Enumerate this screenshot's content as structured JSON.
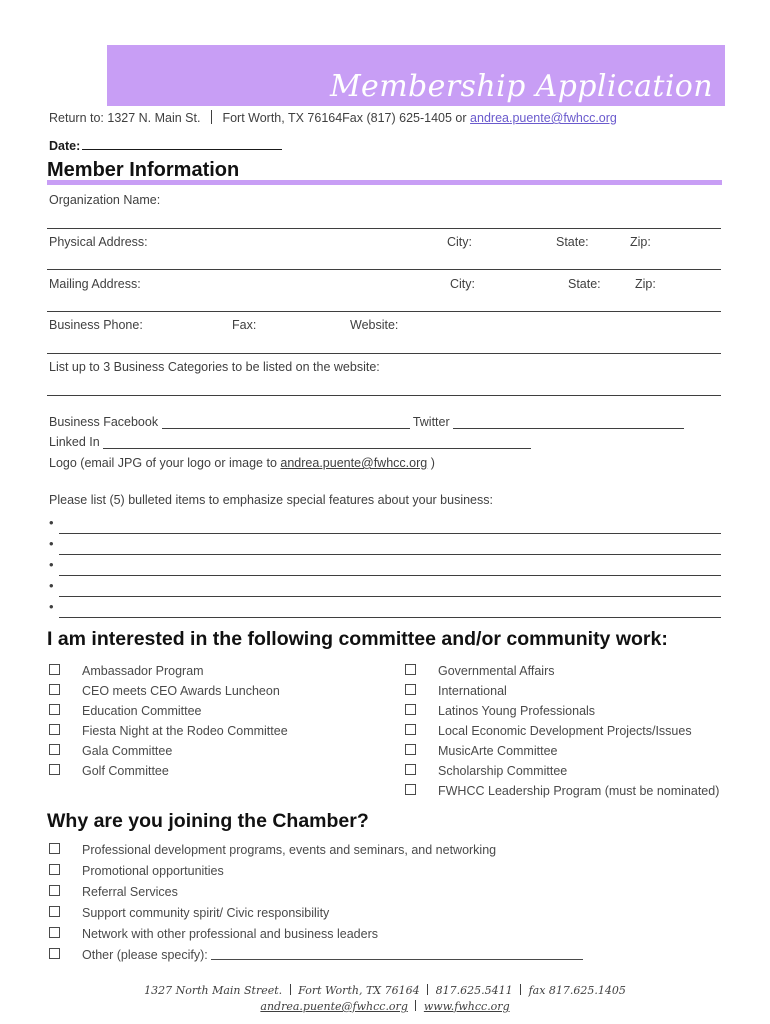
{
  "document": {
    "title": "Membership Application",
    "accent_color": "#c89ef5",
    "link_color": "#6a5acd"
  },
  "header": {
    "banner_title": "Membership Application"
  },
  "return_line": {
    "prefix": "Return to: 1327 N. Main St.",
    "middle": "Fort Worth, TX 76164Fax (817) 625-1405 or",
    "email": "andrea.puente@fwhcc.org"
  },
  "date_field": {
    "label": "Date:"
  },
  "member_section": {
    "heading": "Member Information",
    "rows": [
      {
        "label": "Organization Name:"
      },
      {
        "label": "Physical Address:",
        "city": "City:",
        "state": "State:",
        "zip": "Zip:"
      },
      {
        "label": "Mailing Address:",
        "city": "City:",
        "state": "State:",
        "zip": "Zip:"
      },
      {
        "label": "Business Phone:",
        "fax": "Fax:",
        "website": "Website:"
      },
      {
        "label": "List up to 3 Business Categories to be listed on the website:"
      }
    ]
  },
  "social": {
    "facebook_label": "Business Facebook",
    "twitter_label": "Twitter",
    "linkedin_label": "Linked In",
    "logo_prefix": "Logo (email JPG of your logo or image to",
    "logo_email": "andrea.puente@fwhcc.org",
    "logo_suffix": ")"
  },
  "bullets": {
    "intro": "Please list (5) bulleted items to emphasize special features about your business:",
    "count": 5,
    "marker": "•"
  },
  "committee_section": {
    "heading": "I am interested in the following committee and/or community work:",
    "left_items": [
      "Ambassador Program",
      "CEO meets CEO Awards Luncheon",
      "Education Committee",
      "Fiesta Night at the Rodeo Committee",
      "Gala Committee",
      "Golf Committee"
    ],
    "right_items": [
      "Governmental Affairs",
      "International",
      "Latinos Young Professionals",
      "Local Economic Development Projects/Issues",
      "MusicArte Committee",
      "Scholarship Committee",
      "FWHCC Leadership Program (must be nominated)"
    ]
  },
  "why_section": {
    "heading": "Why are you joining the Chamber?",
    "items": [
      "Professional development programs, events and seminars, and networking",
      "Promotional opportunities",
      "Referral Services",
      "Support community spirit/ Civic responsibility",
      "Network with other professional and business leaders"
    ],
    "other_label": "Other (please specify):"
  },
  "footer": {
    "address": "1327 North Main Street.",
    "city": "Fort Worth, TX 76164",
    "phone": "817.625.5411",
    "fax": "fax 817.625.1405",
    "email": "andrea.puente@fwhcc.org",
    "website": "www.fwhcc.org"
  }
}
